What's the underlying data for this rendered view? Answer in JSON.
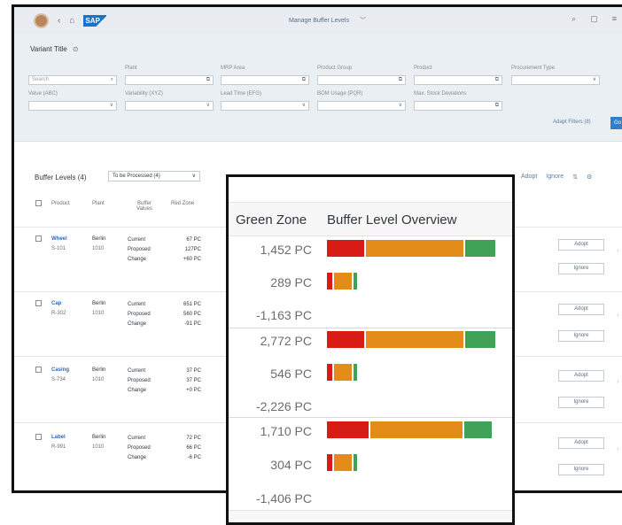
{
  "shell": {
    "title": "Manage Buffer Levels",
    "title_chevron": "﹀",
    "logo_text": "SAP"
  },
  "filter": {
    "variant_title": "Variant Title",
    "fields": [
      {
        "label": "",
        "placeholder": "Search"
      },
      {
        "label": "Plant",
        "placeholder": ""
      },
      {
        "label": "MRP Area",
        "placeholder": ""
      },
      {
        "label": "Product Group",
        "placeholder": ""
      },
      {
        "label": "Product",
        "placeholder": ""
      },
      {
        "label": "Procurement Type",
        "placeholder": ""
      },
      {
        "label": "Value (ABC)",
        "placeholder": ""
      },
      {
        "label": "Variability (XYZ)",
        "placeholder": ""
      },
      {
        "label": "Lead Time (EFG)",
        "placeholder": ""
      },
      {
        "label": "BOM Usage (PQR)",
        "placeholder": ""
      },
      {
        "label": "Max. Stock Deviations",
        "placeholder": ""
      }
    ],
    "adapt_filters": "Adapt Filters (8)",
    "go": "Go"
  },
  "table": {
    "title": "Buffer Levels (4)",
    "select_value": "To be Processed (4)",
    "actions": {
      "adopt": "Adopt",
      "ignore": "Ignore"
    },
    "headers": {
      "product": "Product",
      "plant": "Plant",
      "buffer_values": "Buffer Values",
      "red_zone": "Red Zone"
    },
    "rows": [
      {
        "product": "Wheel",
        "product_id": "S-101",
        "plant": "Berlin",
        "plant_code": "1010",
        "labels": [
          "Current",
          "Proposed",
          "Change"
        ],
        "red": [
          "67 PC",
          "127PC",
          "+60 PC"
        ],
        "adopt": "Adopt",
        "ignore": "Ignore"
      },
      {
        "product": "Cap",
        "product_id": "R-302",
        "plant": "Berlin",
        "plant_code": "1010",
        "labels": [
          "Current",
          "Proposed",
          "Change"
        ],
        "red": [
          "651 PC",
          "560 PC",
          "-91 PC"
        ],
        "adopt": "Adopt",
        "ignore": "Ignore"
      },
      {
        "product": "Casing",
        "product_id": "S-734",
        "plant": "Berlin",
        "plant_code": "1010",
        "labels": [
          "Current",
          "Proposed",
          "Change"
        ],
        "red": [
          "37 PC",
          "37 PC",
          "+0 PC"
        ],
        "adopt": "Adopt",
        "ignore": "Ignore"
      },
      {
        "product": "Label",
        "product_id": "R-991",
        "plant": "Berlin",
        "plant_code": "1010",
        "labels": [
          "Current",
          "Proposed",
          "Change"
        ],
        "red": [
          "72 PC",
          "66 PC",
          "-6 PC"
        ],
        "adopt": "Adopt",
        "ignore": "Ignore"
      }
    ]
  },
  "zoom": {
    "header_green_zone": "Green Zone",
    "header_overview": "Buffer Level Overview",
    "groups": [
      {
        "values": [
          "1,452 PC",
          "289 PC",
          "-1,163 PC"
        ]
      },
      {
        "values": [
          "2,772 PC",
          "546 PC",
          "-2,226 PC"
        ]
      },
      {
        "values": [
          "1,710 PC",
          "304 PC",
          "-1,406 PC"
        ]
      }
    ]
  },
  "colors": {
    "red_zone": "#d81b14",
    "yellow_zone": "#e38c19",
    "green_zone": "#3fa257",
    "link": "#2d6ab5",
    "accent": "#2f80c8"
  },
  "icons": [
    "user-avatar-icon",
    "back-icon",
    "home-icon",
    "search-icon",
    "notification-icon",
    "menu-icon",
    "value-help-icon",
    "dropdown-icon",
    "sort-icon",
    "settings-icon",
    "navigation-arrow-icon"
  ]
}
